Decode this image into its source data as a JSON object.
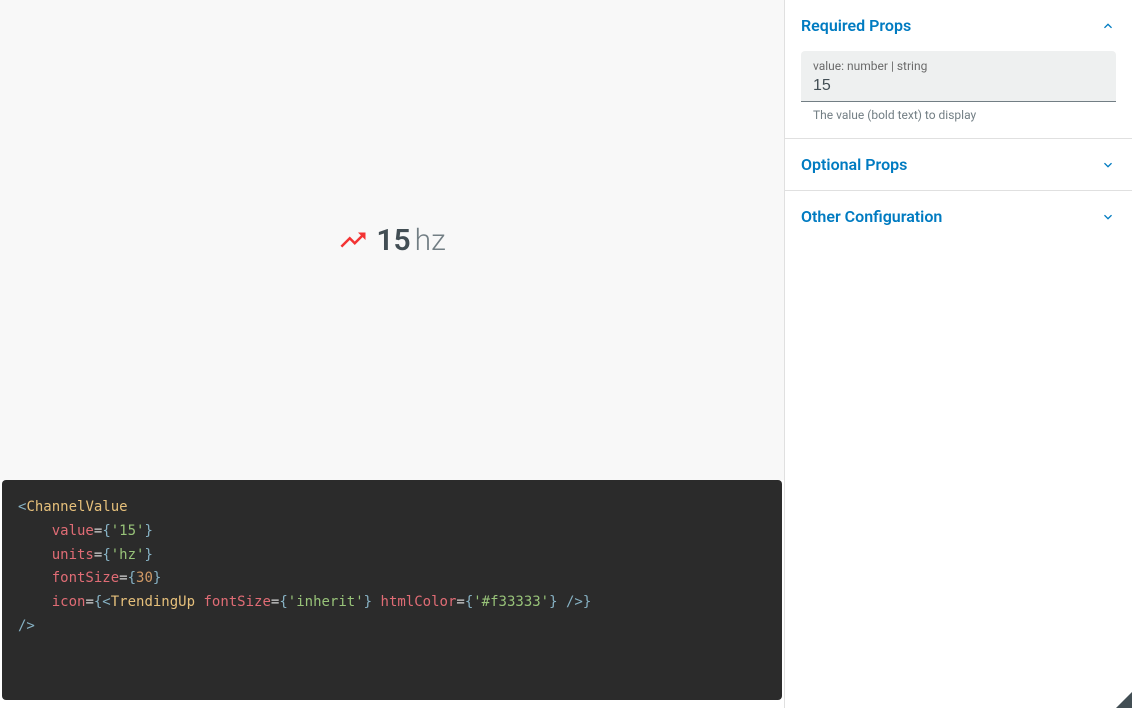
{
  "preview": {
    "value": "15",
    "units": "hz",
    "fontSize": 30,
    "iconColor": "#f33333"
  },
  "code": {
    "component": "ChannelValue",
    "valueAttr": "value",
    "valueVal": "'15'",
    "unitsAttr": "units",
    "unitsVal": "'hz'",
    "fontSizeAttr": "fontSize",
    "fontSizeVal": "30",
    "iconAttr": "icon",
    "iconComp": "TrendingUp",
    "iconFontSizeAttr": "fontSize",
    "iconFontSizeVal": "'inherit'",
    "iconHtmlColorAttr": "htmlColor",
    "iconHtmlColorVal": "'#f33333'"
  },
  "sidebar": {
    "required": {
      "title": "Required Props",
      "valueLabel": "value: number | string",
      "valueInput": "15",
      "helpText": "The value (bold text) to display"
    },
    "optional": {
      "title": "Optional Props"
    },
    "other": {
      "title": "Other Configuration"
    }
  }
}
